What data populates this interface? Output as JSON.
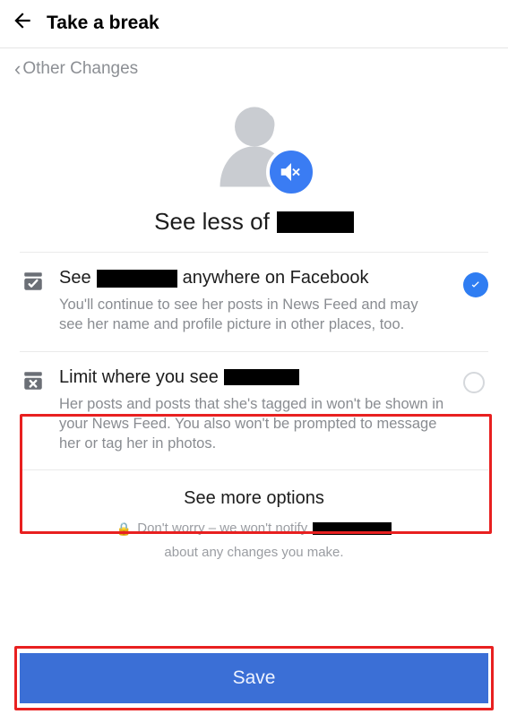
{
  "header": {
    "title": "Take a break"
  },
  "subnav": {
    "back_label": "Other Changes"
  },
  "hero": {
    "title_prefix": "See less of"
  },
  "options": {
    "opt1": {
      "title_prefix": "See",
      "title_suffix": "anywhere on Facebook",
      "desc": "You'll continue to see her posts in News Feed and may see her name and profile picture in other places, too.",
      "selected": true
    },
    "opt2": {
      "title_prefix": "Limit where you see",
      "desc": "Her posts and posts that she's tagged in won't be shown in your News Feed. You also won't be prompted to message her or tag her in photos.",
      "selected": false
    }
  },
  "more_options_label": "See more options",
  "footer": {
    "note_prefix": "Don't worry – we won't notify",
    "note_suffix": "about any changes you make."
  },
  "save_label": "Save"
}
